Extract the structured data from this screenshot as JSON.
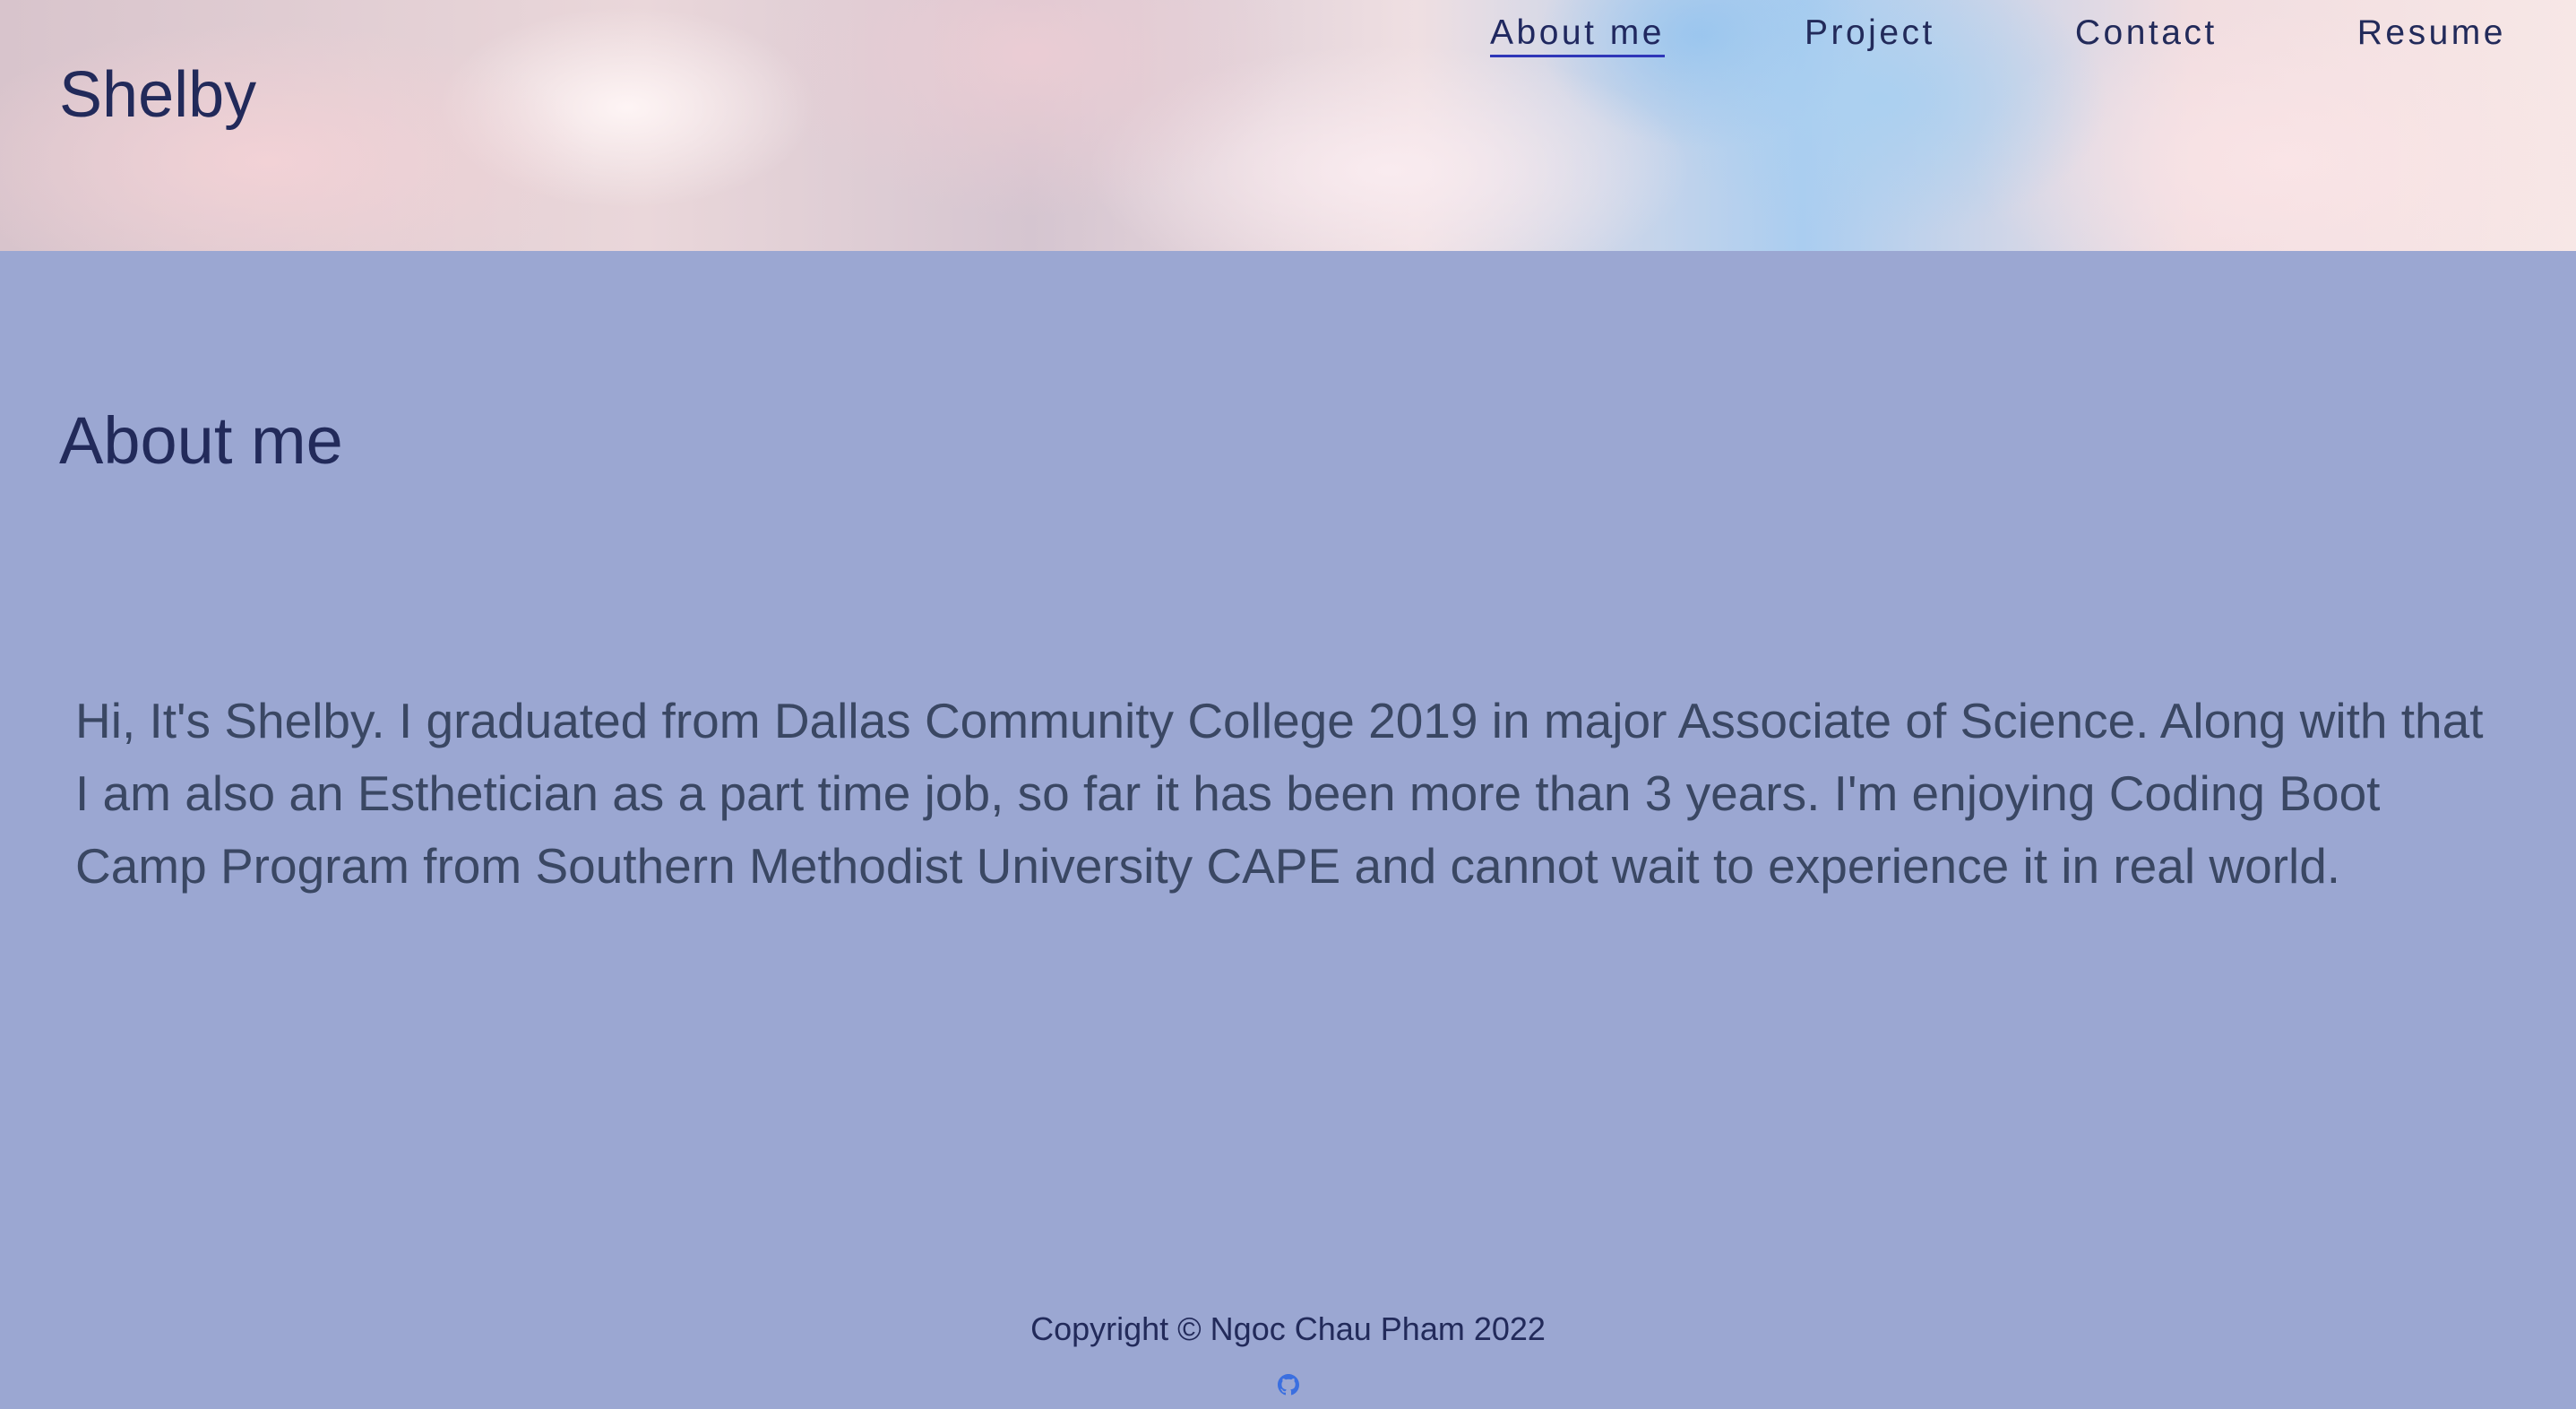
{
  "header": {
    "brand": "Shelby",
    "nav": [
      {
        "label": "About me",
        "active": true
      },
      {
        "label": "Project",
        "active": false
      },
      {
        "label": "Contact",
        "active": false
      },
      {
        "label": "Resume",
        "active": false
      }
    ]
  },
  "main": {
    "title": "About me",
    "bio": "Hi, It's Shelby. I graduated from Dallas Community College 2019 in major Associate of Science. Along with that I am also an Esthetician as a part time job, so far it has been more than 3 years. I'm enjoying Coding Boot Camp Program from Southern Methodist University CAPE and cannot wait to experience it in real world."
  },
  "footer": {
    "copyright": "Copyright © Ngoc Chau Pham 2022",
    "icon": "github-icon"
  },
  "colors": {
    "page_background": "#9ba7d2",
    "heading": "#222a5a",
    "body_text": "#3a4763",
    "nav_underline": "#2f36b8",
    "icon_link": "#3b6fe0"
  }
}
